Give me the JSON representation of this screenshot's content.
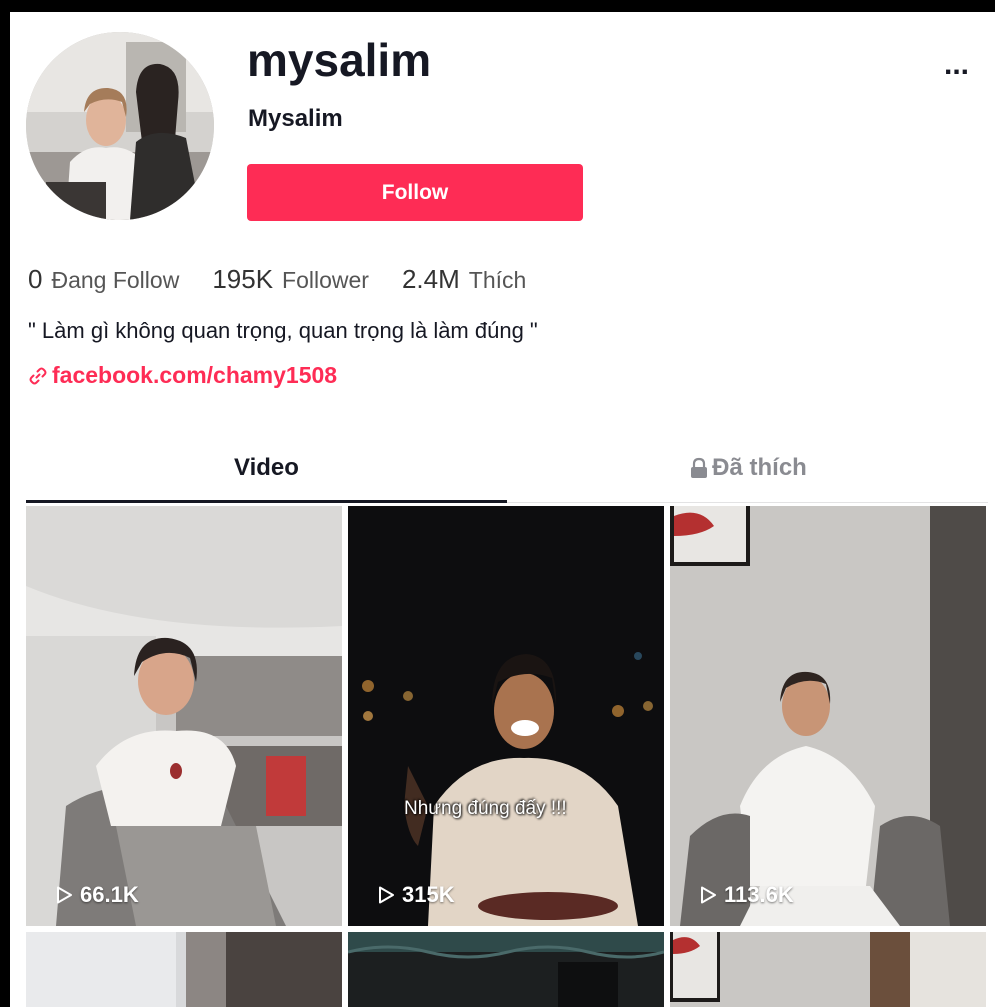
{
  "profile": {
    "username": "mysalim",
    "nickname": "Mysalim",
    "follow_label": "Follow",
    "more_label": "..."
  },
  "stats": [
    {
      "value": "0",
      "label": "Đang Follow"
    },
    {
      "value": "195K",
      "label": "Follower"
    },
    {
      "value": "2.4M",
      "label": "Thích"
    }
  ],
  "bio": "\" Làm gì không quan trọng, quan trọng là làm đúng \"",
  "link": {
    "text": "facebook.com/chamy1508",
    "icon": "link-icon"
  },
  "tabs": [
    {
      "label": "Video",
      "active": true
    },
    {
      "label": "Đã thích",
      "icon": "lock-icon",
      "active": false
    }
  ],
  "videos": [
    {
      "views": "66.1K"
    },
    {
      "views": "315K",
      "caption": "Nhưng đúng đấy !!!"
    },
    {
      "views": "113.6K"
    }
  ],
  "colors": {
    "accent": "#fe2c55",
    "text": "#161823",
    "muted": "#8a8b91"
  }
}
